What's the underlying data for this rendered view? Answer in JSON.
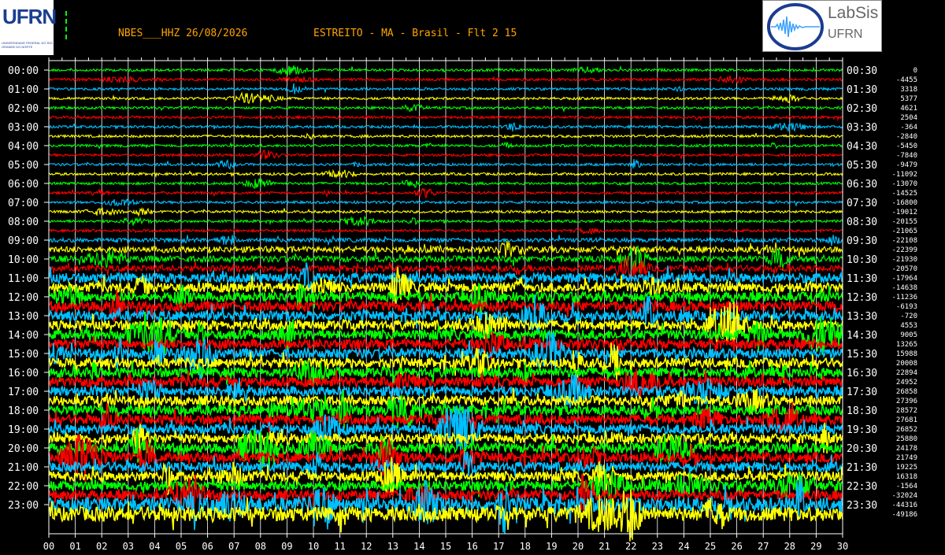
{
  "header": {
    "station": "NBES___HHZ 26/08/2026",
    "location": "ESTREITO - MA - Brasil - Flt 2 15"
  },
  "logos": {
    "left_text": "UFRN",
    "left_subtext": "UNIVERSIDADE FEDERAL DO RIO GRANDE DO NORTE",
    "right_line1": "LabSis",
    "right_line2": "UFRN"
  },
  "colors": {
    "background": "#000000",
    "header": "#ffa500",
    "trace_cycle": [
      "#00ff00",
      "#ff0000",
      "#00bfff",
      "#ffff00"
    ]
  },
  "chart_data": {
    "type": "line",
    "title": "NBES___HHZ 26/08/2026   ESTREITO - MA - Brasil - Flt 2 15",
    "xlabel": "",
    "ylabel": "",
    "x_ticks": [
      "00",
      "01",
      "02",
      "03",
      "04",
      "05",
      "06",
      "07",
      "08",
      "09",
      "10",
      "11",
      "12",
      "13",
      "14",
      "15",
      "16",
      "17",
      "18",
      "19",
      "20",
      "21",
      "22",
      "23",
      "24",
      "25",
      "26",
      "27",
      "28",
      "29",
      "30"
    ],
    "x_range": [
      0,
      30
    ],
    "left_labels": [
      "00:00",
      "01:00",
      "02:00",
      "03:00",
      "04:00",
      "05:00",
      "06:00",
      "07:00",
      "08:00",
      "09:00",
      "10:00",
      "11:00",
      "12:00",
      "13:00",
      "14:00",
      "15:00",
      "16:00",
      "17:00",
      "18:00",
      "19:00",
      "20:00",
      "21:00",
      "22:00",
      "23:00"
    ],
    "right_labels": [
      "00:30",
      "01:30",
      "02:30",
      "03:30",
      "04:30",
      "05:30",
      "06:30",
      "07:30",
      "08:30",
      "09:30",
      "10:30",
      "11:30",
      "12:30",
      "13:30",
      "14:30",
      "15:30",
      "16:30",
      "17:30",
      "18:30",
      "19:30",
      "20:30",
      "21:30",
      "22:30",
      "23:30"
    ],
    "offsets": [
      0,
      -4455,
      3318,
      5377,
      4621,
      2504,
      -364,
      -2840,
      -5450,
      -7840,
      -9479,
      -11092,
      -13070,
      -14525,
      -16800,
      -19012,
      -20155,
      -21065,
      -22108,
      -22399,
      -21930,
      -20570,
      -17964,
      -14638,
      -11236,
      -6193,
      -720,
      4553,
      9005,
      13265,
      15988,
      20008,
      22894,
      24952,
      26858,
      27396,
      28572,
      27681,
      26852,
      25880,
      24178,
      21749,
      19225,
      16318,
      -1564,
      -32024,
      -44316,
      -49186
    ],
    "trace_count": 48,
    "grid": true,
    "vertical_grid": "every 1 minute",
    "noise_levels": [
      1,
      1,
      1,
      1,
      1,
      1,
      1,
      1,
      1,
      1,
      1,
      1,
      1,
      1,
      1,
      1,
      1,
      1,
      2,
      3,
      3,
      3,
      4,
      4,
      4,
      4,
      4,
      4,
      4,
      4,
      4,
      4,
      4,
      4,
      4,
      4,
      4,
      4,
      4,
      4,
      4,
      4,
      4,
      4,
      4,
      4,
      5,
      5
    ]
  }
}
